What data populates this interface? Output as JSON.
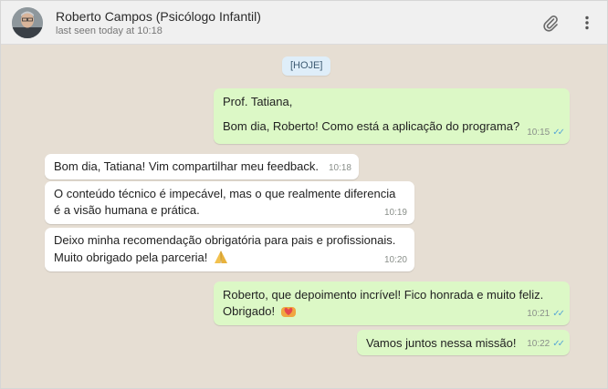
{
  "header": {
    "contact_name": "Roberto Campos (Psicólogo Infantil)",
    "last_seen": "last seen today at 10:18",
    "icons": [
      "avatar",
      "paperclip-icon",
      "more-vertical-icon"
    ]
  },
  "chat": {
    "date_chip": "[HOJE]",
    "messages": [
      {
        "direction": "out",
        "lines": [
          "Prof. Tatiana,",
          "Bom dia, Roberto! Como está a aplicação do programa?"
        ],
        "time": "10:15",
        "status": "read"
      },
      {
        "direction": "in",
        "lines": [
          "Bom dia, Tatiana! Vim compartilhar meu feedback."
        ],
        "time": "10:18"
      },
      {
        "direction": "in",
        "lines": [
          "O conteúdo técnico é impecável, mas o que realmente diferencia",
          "é a visão humana e prática."
        ],
        "time": "10:19"
      },
      {
        "direction": "in",
        "lines": [
          "Deixo minha recomendação obrigatória para pais e profissionais.",
          "Muito obrigado pela parceria!"
        ],
        "emoji": "folded-hands",
        "time": "10:20"
      },
      {
        "direction": "out",
        "lines": [
          "Roberto, que depoimento incrível! Fico honrada e muito feliz.",
          "Obrigado!"
        ],
        "emoji": "heart-hands",
        "time": "10:21",
        "status": "read"
      },
      {
        "direction": "out",
        "lines": [
          "Vamos juntos nessa missão!"
        ],
        "time": "10:22",
        "status": "read"
      }
    ]
  },
  "colors": {
    "header_bg": "#f0f0f0",
    "chat_bg": "#e6ded3",
    "outgoing_bubble": "#dcf8c6",
    "incoming_bubble": "#ffffff",
    "read_ticks": "#58a8d6"
  }
}
